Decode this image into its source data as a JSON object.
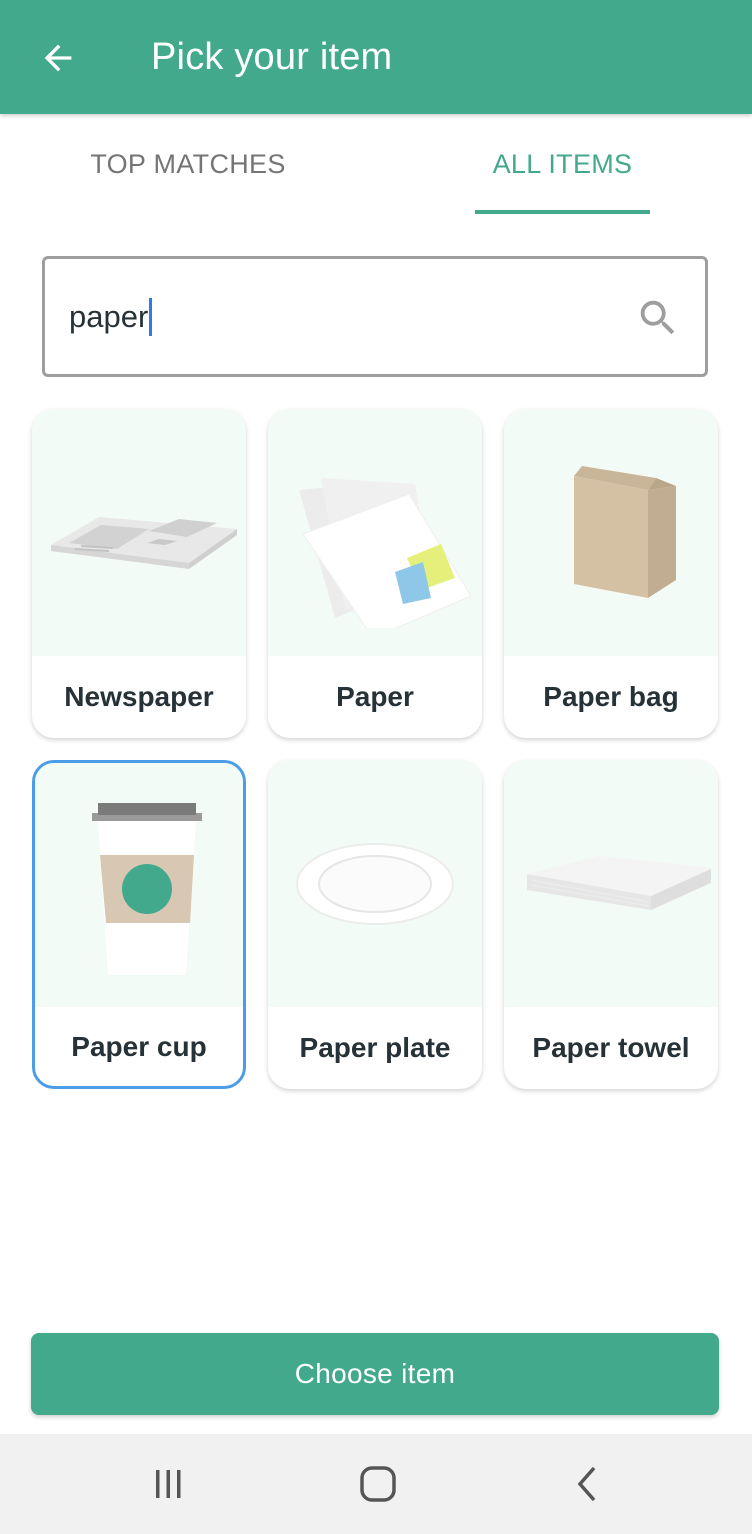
{
  "appbar": {
    "title": "Pick your item",
    "back_icon": "arrow-left-icon",
    "color": "#43a98d"
  },
  "tabs": [
    {
      "label": "TOP MATCHES",
      "active": false
    },
    {
      "label": "ALL ITEMS",
      "active": true
    }
  ],
  "search": {
    "value": "paper",
    "icon": "search-icon"
  },
  "items": [
    {
      "label": "Newspaper",
      "icon": "newspaper-icon",
      "selected": false
    },
    {
      "label": "Paper",
      "icon": "paper-sheets-icon",
      "selected": false
    },
    {
      "label": "Paper bag",
      "icon": "paper-bag-icon",
      "selected": false
    },
    {
      "label": "Paper cup",
      "icon": "paper-cup-icon",
      "selected": true
    },
    {
      "label": "Paper plate",
      "icon": "paper-plate-icon",
      "selected": false
    },
    {
      "label": "Paper towel",
      "icon": "paper-towel-icon",
      "selected": false
    }
  ],
  "actions": {
    "choose_label": "Choose item"
  },
  "system_nav": {
    "recents_icon": "recents-icon",
    "home_icon": "home-icon",
    "back_icon": "back-chevron-icon"
  },
  "colors": {
    "accent": "#43a98d",
    "selection": "#4a9de6",
    "card_bg": "#f3fbf6"
  }
}
